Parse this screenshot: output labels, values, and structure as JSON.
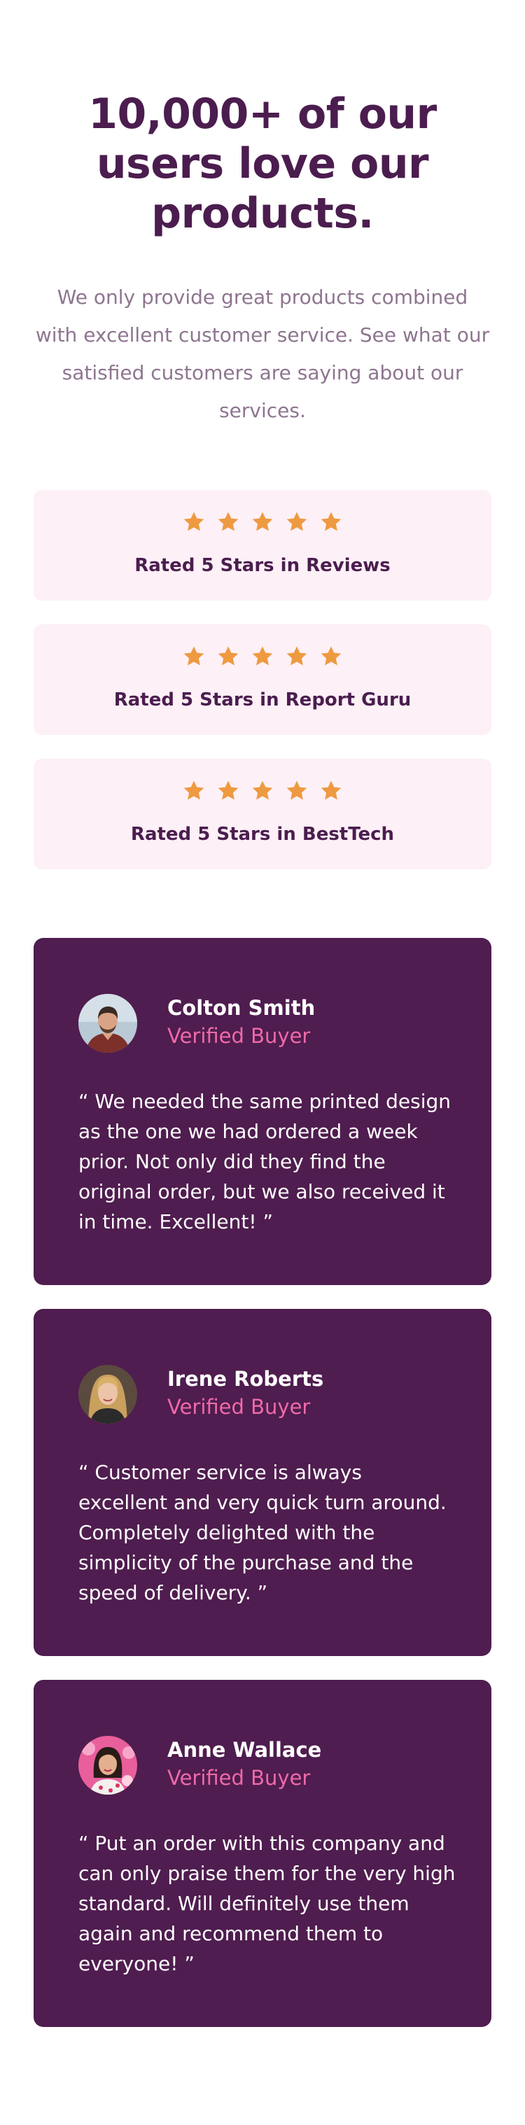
{
  "header": {
    "title": "10,000+ of our users love our products.",
    "subtitle": "We only provide great products combined with excellent customer service. See what our satisfied customers are saying about our services."
  },
  "ratings": [
    {
      "stars": 5,
      "label": "Rated 5 Stars in Reviews"
    },
    {
      "stars": 5,
      "label": "Rated 5 Stars in Report Guru"
    },
    {
      "stars": 5,
      "label": "Rated 5 Stars in BestTech"
    }
  ],
  "testimonials": [
    {
      "name": "Colton Smith",
      "status": "Verified Buyer",
      "quote": "“ We needed the same printed design as the one we had ordered a week prior. Not only did they find the original order, but we also received it in time. Excellent! ”"
    },
    {
      "name": "Irene Roberts",
      "status": "Verified Buyer",
      "quote": "“ Customer service is always excellent and very quick turn around. Completely delighted with the simplicity of the purchase and the speed of delivery. ”"
    },
    {
      "name": "Anne Wallace",
      "status": "Verified Buyer",
      "quote": "“ Put an order with this company and can only praise them for the very high standard. Will definitely use them again and recommend them to everyone! ”"
    }
  ],
  "colors": {
    "heading": "#4b1d4f",
    "subtitle": "#8e7590",
    "rating_card_bg": "#fdf0f6",
    "star": "#ee9a41",
    "testimonial_bg": "#4f1d4f",
    "verified": "#ee6aa7",
    "quote_text": "#ffffff"
  },
  "icons": {
    "star": "star-icon",
    "avatars": [
      "avatar-colton-smith",
      "avatar-irene-roberts",
      "avatar-anne-wallace"
    ]
  }
}
